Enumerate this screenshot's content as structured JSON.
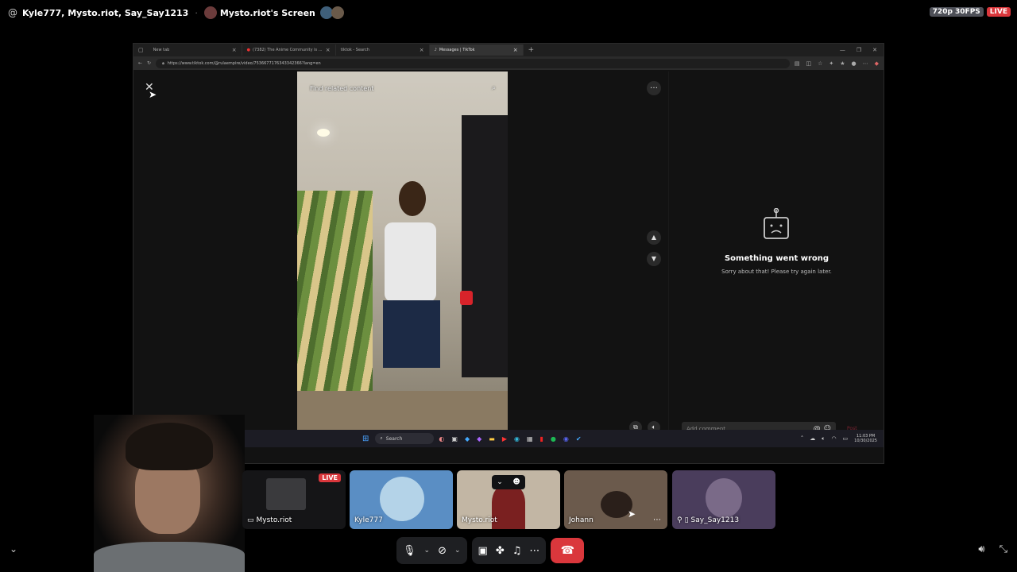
{
  "call_header": {
    "participants": "Kyle777, Mysto.riot, Say_Say1213",
    "screen_owner": "Mysto.riot's Screen",
    "quality": "720p 30FPS",
    "live": "LIVE"
  },
  "browser": {
    "tabs": [
      {
        "label": "New tab",
        "active": false
      },
      {
        "label": "(7382) The Anime Community is ...",
        "active": false
      },
      {
        "label": "tiktok - Search",
        "active": false
      },
      {
        "label": "Messages | TikTok",
        "active": true
      }
    ],
    "url": "https://www.tiktok.com/@rulaempire/video/7536677176343342366?lang=en"
  },
  "tiktok": {
    "find_placeholder": "Find related content",
    "error_title": "Something went wrong",
    "error_subtitle": "Sorry about that! Please try again later.",
    "comment_placeholder": "Add comment...",
    "post_label": "Post"
  },
  "taskbar": {
    "search_label": "Search",
    "time": "11:03 PM",
    "date": "10/30/2025"
  },
  "tiles": [
    {
      "name": "Mysto.riot",
      "live": "LIVE"
    },
    {
      "name": "Kyle777"
    },
    {
      "name": "Mysto.riot"
    },
    {
      "name": "Johann"
    },
    {
      "name": "Say_Say1213"
    }
  ],
  "colors": {
    "live_red": "#da373c",
    "end_call_red": "#da373c",
    "control_bg": "#1e1f22"
  }
}
